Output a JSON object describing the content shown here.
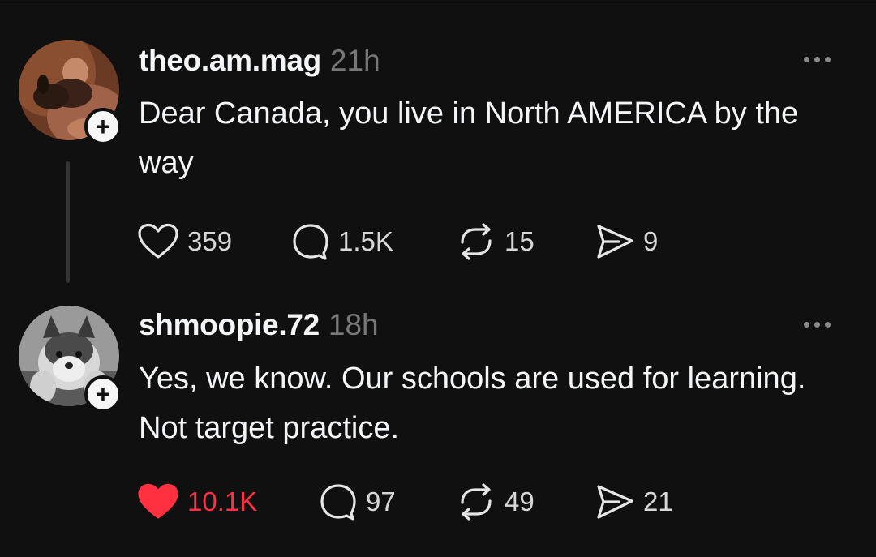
{
  "posts": [
    {
      "username": "theo.am.mag",
      "time": "21h",
      "text": "Dear Canada, you live in North AMERICA by the way",
      "liked": false,
      "likes": "359",
      "replies": "1.5K",
      "reposts": "15",
      "shares": "9"
    },
    {
      "username": "shmoopie.72",
      "time": "18h",
      "text": "Yes, we know. Our schools are used for learning. Not target practice.",
      "liked": true,
      "likes": "10.1K",
      "replies": "97",
      "reposts": "49",
      "shares": "21"
    }
  ],
  "icons": {
    "like": "heart-icon",
    "reply": "comment-bubble-icon",
    "repost": "repost-icon",
    "share": "send-icon",
    "follow": "plus-icon",
    "more": "more-dots-icon"
  },
  "colors": {
    "background": "#101010",
    "liked_red": "#ff3040",
    "muted": "#777777"
  }
}
